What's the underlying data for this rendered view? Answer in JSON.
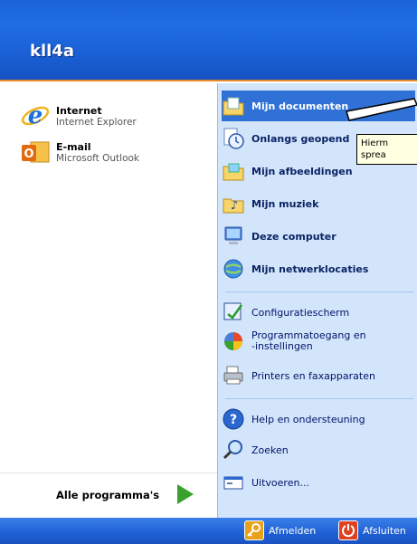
{
  "header": {
    "user_name": "kll4a"
  },
  "pinned": [
    {
      "title": "Internet",
      "subtitle": "Internet Explorer",
      "icon": "internet-explorer-icon"
    },
    {
      "title": "E-mail",
      "subtitle": "Microsoft Outlook",
      "icon": "outlook-icon"
    }
  ],
  "all_programs": {
    "label": "Alle programma's",
    "icon": "green-arrow-icon"
  },
  "right": {
    "items": [
      {
        "label": "Mijn documenten",
        "icon": "my-documents-icon"
      },
      {
        "label": "Onlangs geopend",
        "icon": "recent-documents-icon"
      },
      {
        "label": "Mijn afbeeldingen",
        "icon": "my-pictures-icon"
      },
      {
        "label": "Mijn muziek",
        "icon": "my-music-icon"
      },
      {
        "label": "Deze computer",
        "icon": "my-computer-icon"
      },
      {
        "label": "Mijn netwerklocaties",
        "icon": "network-places-icon"
      },
      {
        "label": "Configuratiescherm",
        "icon": "control-panel-icon"
      },
      {
        "label": "Programmatoegang en -instellingen",
        "label_line1": "Programmatoegang en",
        "label_line2": "-instellingen",
        "icon": "program-access-icon"
      },
      {
        "label": "Printers en faxapparaten",
        "icon": "printers-icon"
      },
      {
        "label": "Help en ondersteuning",
        "icon": "help-icon"
      },
      {
        "label": "Zoeken",
        "icon": "search-icon"
      },
      {
        "label": "Uitvoeren...",
        "icon": "run-icon"
      }
    ]
  },
  "tooltip": {
    "line1": "Hierm",
    "line2": "sprea"
  },
  "footer": {
    "logoff_label": "Afmelden",
    "shutdown_label": "Afsluiten"
  },
  "colors": {
    "header_blue": "#1f6ee4",
    "right_pane": "#d3e5fa",
    "highlight": "#2f71d6",
    "accent_orange": "#e88a2e"
  }
}
